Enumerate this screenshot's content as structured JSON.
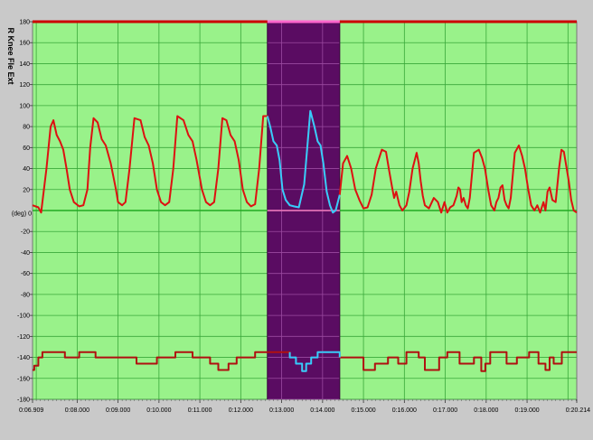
{
  "chart_data": {
    "type": "line",
    "ylabel": "R Knee Fle Ext",
    "unit_label": "(deg) 0",
    "ylim": [
      -180,
      180
    ],
    "y_ticks": [
      180,
      160,
      140,
      120,
      100,
      80,
      60,
      40,
      20,
      -20,
      -40,
      -60,
      -80,
      -100,
      -120,
      -140,
      -160,
      -180
    ],
    "x_range": [
      6.909,
      20.214
    ],
    "x_ticks": [
      {
        "x": 6.909,
        "label": "0:06.909"
      },
      {
        "x": 8.0,
        "label": "0:08.000"
      },
      {
        "x": 9.0,
        "label": "0:09.000"
      },
      {
        "x": 10.0,
        "label": "0:10.000"
      },
      {
        "x": 11.0,
        "label": "0:11.000"
      },
      {
        "x": 12.0,
        "label": "0:12.000"
      },
      {
        "x": 13.0,
        "label": "0:13.000"
      },
      {
        "x": 14.0,
        "label": "0:14.000"
      },
      {
        "x": 15.0,
        "label": "0:15.000"
      },
      {
        "x": 16.0,
        "label": "0:16.000"
      },
      {
        "x": 17.0,
        "label": "0:17.000"
      },
      {
        "x": 18.0,
        "label": "0:18.000"
      },
      {
        "x": 19.0,
        "label": "0:19.000"
      },
      {
        "x": 20.214,
        "label": "0:20.214"
      }
    ],
    "selection": {
      "x_start": 12.65,
      "x_end": 14.42
    },
    "reference_lines": [
      {
        "y": 180,
        "color": "#cc0000"
      },
      {
        "y": 0,
        "color": "#22aa22"
      }
    ],
    "series": [
      {
        "color": "#dd1111",
        "highlight_color": "#33ccff",
        "x": [
          6.909,
          7.05,
          7.12,
          7.25,
          7.35,
          7.42,
          7.5,
          7.58,
          7.66,
          7.74,
          7.82,
          7.92,
          8.05,
          8.15,
          8.25,
          8.32,
          8.4,
          8.5,
          8.6,
          8.7,
          8.82,
          8.95,
          9.0,
          9.1,
          9.18,
          9.28,
          9.4,
          9.55,
          9.65,
          9.75,
          9.85,
          9.95,
          10.05,
          10.15,
          10.25,
          10.35,
          10.45,
          10.6,
          10.72,
          10.82,
          10.92,
          11.05,
          11.15,
          11.25,
          11.35,
          11.45,
          11.55,
          11.65,
          11.75,
          11.85,
          11.95,
          12.05,
          12.15,
          12.25,
          12.35,
          12.45,
          12.55,
          12.65,
          12.72,
          12.8,
          12.88,
          12.95,
          13.02,
          13.1,
          13.2,
          13.3,
          13.42,
          13.55,
          13.7,
          13.8,
          13.88,
          13.95,
          14.02,
          14.1,
          14.18,
          14.25,
          14.32,
          14.42,
          14.5,
          14.6,
          14.7,
          14.8,
          14.9,
          15.0,
          15.1,
          15.2,
          15.3,
          15.45,
          15.55,
          15.62,
          15.7,
          15.75,
          15.8,
          15.88,
          15.95,
          16.05,
          16.12,
          16.2,
          16.3,
          16.35,
          16.4,
          16.45,
          16.5,
          16.6,
          16.72,
          16.82,
          16.9,
          16.98,
          17.05,
          17.12,
          17.2,
          17.28,
          17.32,
          17.36,
          17.4,
          17.45,
          17.5,
          17.55,
          17.6,
          17.7,
          17.82,
          17.9,
          17.97,
          18.05,
          18.12,
          18.2,
          18.25,
          18.3,
          18.35,
          18.4,
          18.45,
          18.5,
          18.55,
          18.6,
          18.7,
          18.8,
          18.88,
          18.95,
          19.02,
          19.1,
          19.18,
          19.25,
          19.32,
          19.4,
          19.45,
          19.5,
          19.55,
          19.62,
          19.7,
          19.78,
          19.84,
          19.9,
          19.96,
          20.02,
          20.08,
          20.14,
          20.214
        ],
        "y": [
          5,
          3,
          -2,
          40,
          80,
          86,
          72,
          66,
          58,
          40,
          20,
          8,
          4,
          5,
          20,
          60,
          88,
          84,
          68,
          62,
          45,
          20,
          8,
          5,
          8,
          40,
          88,
          86,
          70,
          62,
          45,
          20,
          8,
          5,
          8,
          40,
          90,
          86,
          72,
          66,
          48,
          20,
          8,
          5,
          8,
          40,
          88,
          86,
          72,
          66,
          48,
          20,
          8,
          4,
          6,
          40,
          90,
          90,
          80,
          66,
          62,
          48,
          20,
          10,
          5,
          4,
          3,
          25,
          95,
          80,
          66,
          62,
          45,
          18,
          5,
          -2,
          0,
          15,
          45,
          52,
          40,
          20,
          10,
          2,
          3,
          15,
          40,
          58,
          56,
          40,
          22,
          12,
          18,
          5,
          0,
          5,
          18,
          40,
          55,
          45,
          28,
          14,
          5,
          2,
          12,
          8,
          -2,
          8,
          -2,
          3,
          5,
          14,
          22,
          20,
          8,
          12,
          5,
          2,
          12,
          55,
          58,
          50,
          40,
          20,
          5,
          0,
          8,
          12,
          22,
          24,
          10,
          5,
          2,
          12,
          55,
          62,
          52,
          40,
          22,
          5,
          0,
          5,
          -2,
          8,
          0,
          18,
          22,
          10,
          8,
          40,
          58,
          56,
          42,
          28,
          10,
          0,
          -2
        ]
      },
      {
        "color": "#b01010",
        "highlight_color": "#33ccff",
        "x": [
          6.909,
          6.95,
          6.95,
          7.05,
          7.05,
          7.15,
          7.15,
          7.7,
          7.7,
          8.05,
          8.05,
          8.45,
          8.45,
          9.45,
          9.45,
          9.95,
          9.95,
          10.4,
          10.4,
          10.82,
          10.82,
          11.25,
          11.25,
          11.45,
          11.45,
          11.7,
          11.7,
          11.9,
          11.9,
          12.35,
          12.35,
          12.55,
          12.55,
          13.2,
          13.2,
          13.35,
          13.35,
          13.5,
          13.5,
          13.6,
          13.6,
          13.72,
          13.72,
          13.88,
          13.88,
          14.42,
          14.42,
          15.0,
          15.0,
          15.28,
          15.28,
          15.6,
          15.6,
          15.85,
          15.85,
          16.05,
          16.05,
          16.35,
          16.35,
          16.5,
          16.5,
          16.85,
          16.85,
          17.05,
          17.05,
          17.35,
          17.35,
          17.7,
          17.7,
          17.88,
          17.88,
          17.98,
          17.98,
          18.1,
          18.1,
          18.5,
          18.5,
          18.75,
          18.75,
          19.05,
          19.05,
          19.28,
          19.28,
          19.45,
          19.45,
          19.55,
          19.55,
          19.65,
          19.65,
          19.85,
          19.85,
          20.214
        ],
        "y": [
          -152,
          -152,
          -148,
          -148,
          -140,
          -140,
          -135,
          -135,
          -140,
          -140,
          -135,
          -135,
          -140,
          -140,
          -146,
          -146,
          -140,
          -140,
          -135,
          -135,
          -140,
          -140,
          -146,
          -146,
          -152,
          -152,
          -146,
          -146,
          -140,
          -140,
          -135,
          -135,
          -135,
          -135,
          -140,
          -140,
          -146,
          -146,
          -153,
          -153,
          -146,
          -146,
          -140,
          -140,
          -135,
          -135,
          -140,
          -140,
          -152,
          -152,
          -146,
          -146,
          -140,
          -140,
          -146,
          -146,
          -135,
          -135,
          -140,
          -140,
          -152,
          -152,
          -140,
          -140,
          -135,
          -135,
          -146,
          -146,
          -140,
          -140,
          -153,
          -153,
          -146,
          -146,
          -135,
          -135,
          -146,
          -146,
          -140,
          -140,
          -135,
          -135,
          -146,
          -146,
          -152,
          -152,
          -140,
          -140,
          -146,
          -146,
          -135,
          -135
        ]
      }
    ]
  }
}
